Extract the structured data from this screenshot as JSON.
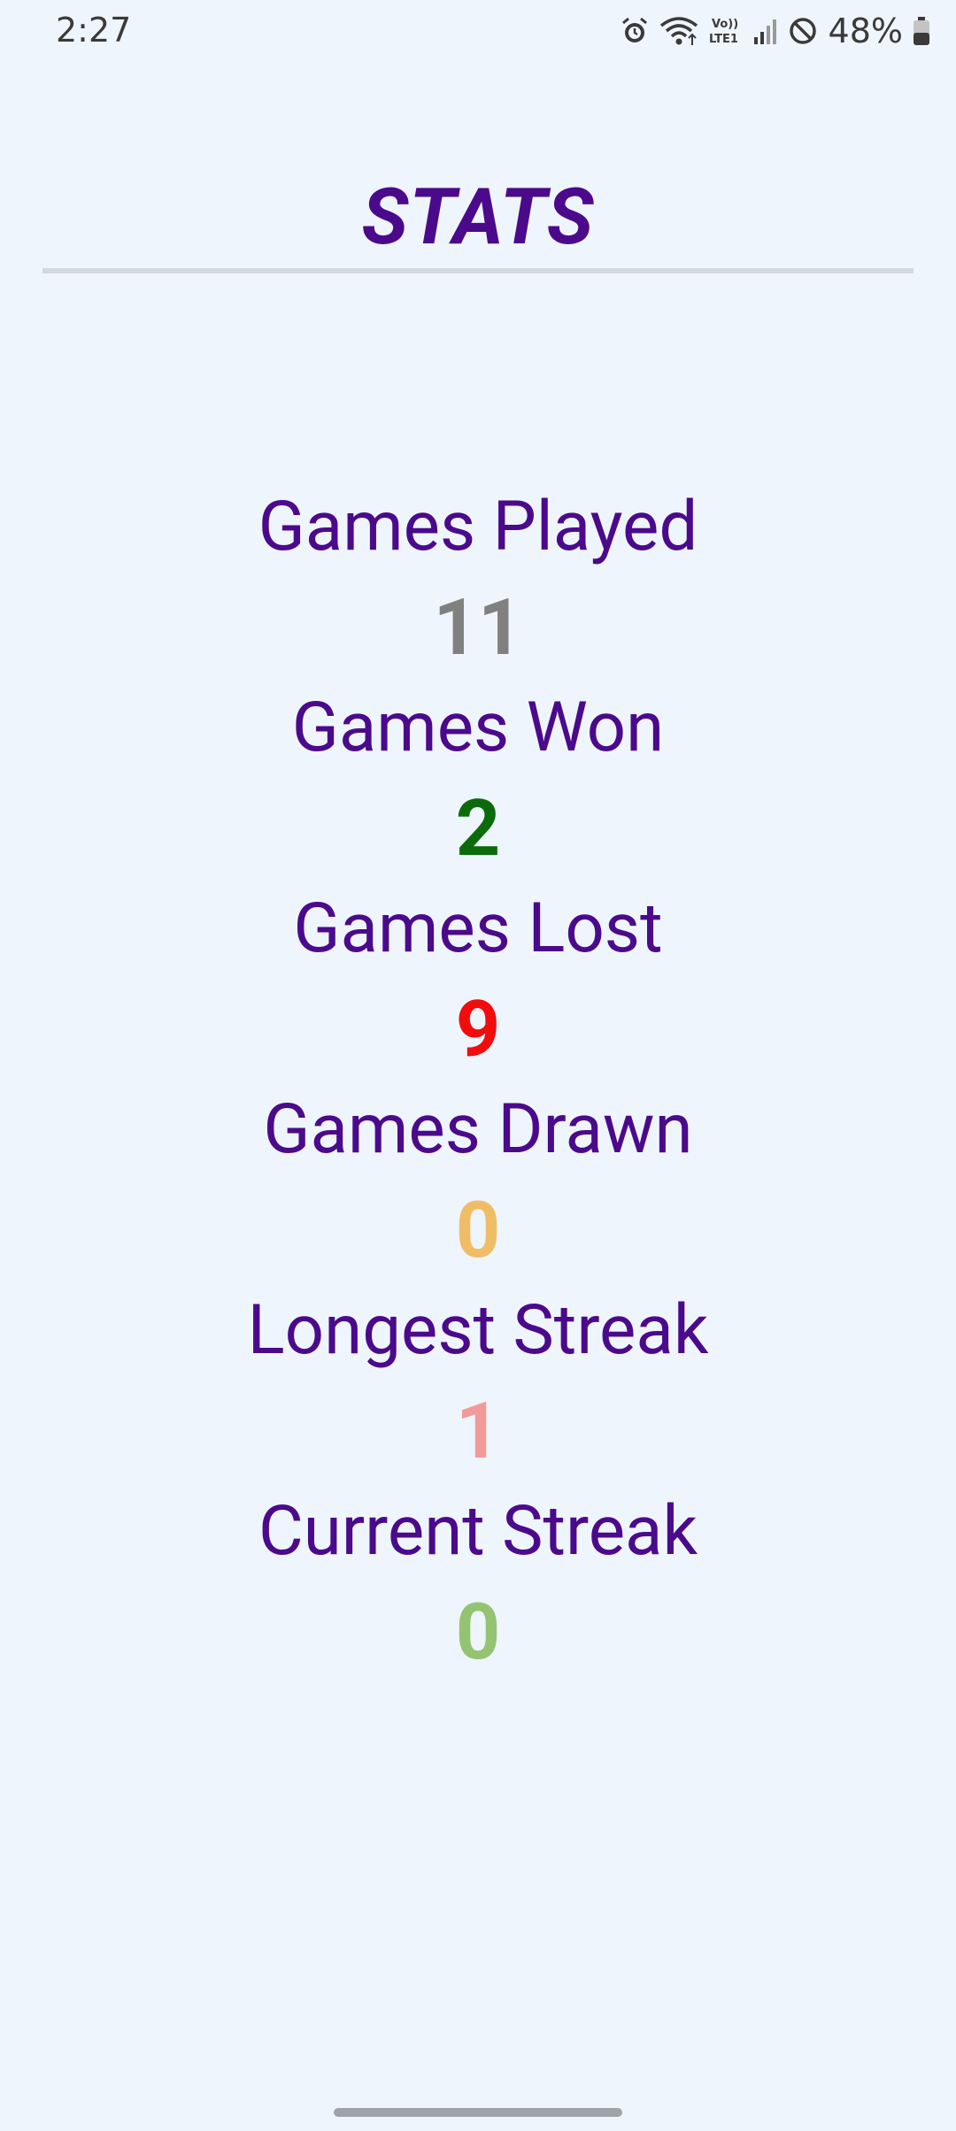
{
  "status_bar": {
    "time": "2:27",
    "battery_percent": "48%",
    "icons": [
      "alarm-icon",
      "wifi-icon",
      "volte-icon",
      "signal-icon",
      "do-not-disturb-icon",
      "battery-icon"
    ]
  },
  "page": {
    "title": "STATS"
  },
  "stats": [
    {
      "label": "Games Played",
      "value": "11",
      "color": "#808080"
    },
    {
      "label": "Games Won",
      "value": "2",
      "color": "#0b6b0b"
    },
    {
      "label": "Games Lost",
      "value": "9",
      "color": "#f20c0c"
    },
    {
      "label": "Games Drawn",
      "value": "0",
      "color": "#f0bd67"
    },
    {
      "label": "Longest Streak",
      "value": "1",
      "color": "#f29a9a"
    },
    {
      "label": "Current Streak",
      "value": "0",
      "color": "#94c472"
    }
  ],
  "colors": {
    "background": "#eff5fc",
    "accent": "#4b0a8c"
  }
}
